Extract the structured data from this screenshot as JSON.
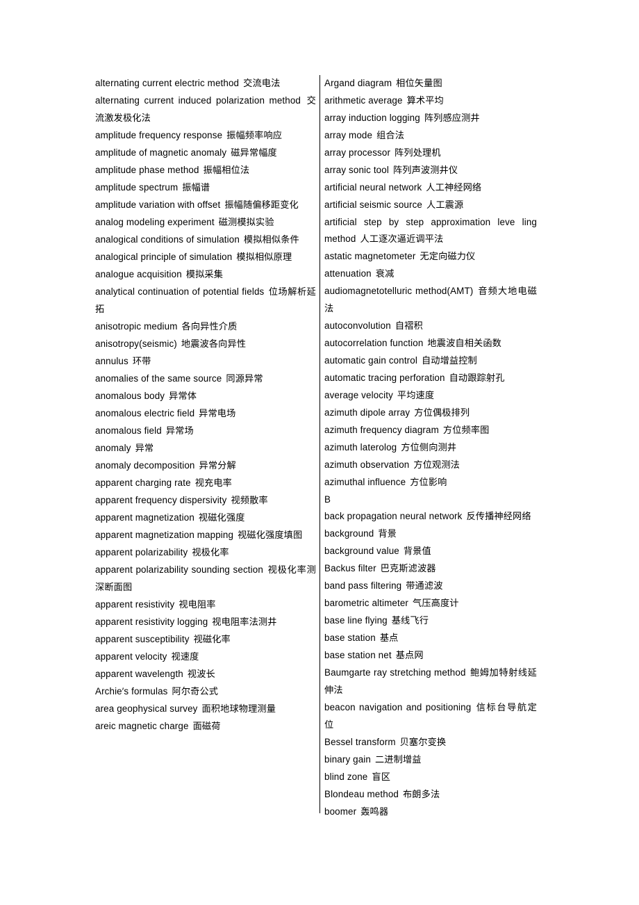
{
  "document": {
    "type": "bilingual-glossary",
    "page_background": "#ffffff",
    "text_color": "#000000",
    "divider_color": "#000000",
    "columns": 2
  },
  "left_column": {
    "entries": [
      {
        "en": "alternating current electric method",
        "zh": "交流电法"
      },
      {
        "en": "alternating current induced polarization method",
        "zh": "交流激发极化法"
      },
      {
        "en": "amplitude frequency response",
        "zh": "振幅频率响应"
      },
      {
        "en": "amplitude of magnetic anomaly",
        "zh": "磁异常幅度"
      },
      {
        "en": "amplitude phase method",
        "zh": "振幅相位法"
      },
      {
        "en": "amplitude spectrum",
        "zh": "振幅谱"
      },
      {
        "en": "amplitude variation with offset",
        "zh": "振幅随偏移距变化"
      },
      {
        "en": "analog modeling experiment",
        "zh": "磁测模拟实验"
      },
      {
        "en": "analogical conditions of simulation",
        "zh": "模拟相似条件"
      },
      {
        "en": "analogical principle of simulation",
        "zh": "模拟相似原理"
      },
      {
        "en": "analogue acquisition",
        "zh": "模拟采集"
      },
      {
        "en": "analytical continuation of potential fields",
        "zh": "位场解析延拓"
      },
      {
        "en": "anisotropic medium",
        "zh": "各向异性介质"
      },
      {
        "en": "anisotropy(seismic)",
        "zh": "地震波各向异性"
      },
      {
        "en": "annulus",
        "zh": "环带"
      },
      {
        "en": "anomalies of the same source",
        "zh": "同源异常"
      },
      {
        "en": "anomalous body",
        "zh": "异常体"
      },
      {
        "en": "anomalous electric field",
        "zh": "异常电场"
      },
      {
        "en": "anomalous field",
        "zh": "异常场"
      },
      {
        "en": "anomaly",
        "zh": "异常"
      },
      {
        "en": "anomaly decomposition",
        "zh": "异常分解"
      },
      {
        "en": "apparent charging rate",
        "zh": "视充电率"
      },
      {
        "en": "apparent frequency dispersivity",
        "zh": "视频散率"
      },
      {
        "en": "apparent magnetization",
        "zh": "视磁化强度"
      },
      {
        "en": "apparent magnetization mapping",
        "zh": "视磁化强度填图"
      },
      {
        "en": "apparent polarizability",
        "zh": "视极化率"
      },
      {
        "en": "apparent polarizability sounding section",
        "zh": "视极化率测深断面图"
      },
      {
        "en": "apparent resistivity",
        "zh": "视电阻率"
      },
      {
        "en": "apparent resistivity logging",
        "zh": "视电阻率法测井"
      },
      {
        "en": "apparent susceptibility",
        "zh": "视磁化率"
      },
      {
        "en": "apparent velocity",
        "zh": "视速度"
      },
      {
        "en": "apparent wavelength",
        "zh": "视波长"
      },
      {
        "en": "Archie′s formulas",
        "zh": "阿尔奇公式"
      },
      {
        "en": "area geophysical survey",
        "zh": "面积地球物理测量"
      },
      {
        "en": "areic magnetic charge",
        "zh": "面磁荷"
      }
    ]
  },
  "right_column": {
    "entries": [
      {
        "en": "Argand diagram",
        "zh": "相位矢量图"
      },
      {
        "en": "arithmetic average",
        "zh": "算术平均"
      },
      {
        "en": "array induction logging",
        "zh": "阵列感应测井"
      },
      {
        "en": "array mode",
        "zh": "组合法"
      },
      {
        "en": "array processor",
        "zh": "阵列处理机"
      },
      {
        "en": "array sonic tool",
        "zh": "阵列声波测井仪"
      },
      {
        "en": "artificial neural network",
        "zh": "人工神经网络"
      },
      {
        "en": "artificial seismic source",
        "zh": "人工震源"
      },
      {
        "en": "artificial step by step approximation leve ling method",
        "zh": "人工逐次逼近调平法"
      },
      {
        "en": "astatic magnetometer",
        "zh": "无定向磁力仪"
      },
      {
        "en": "attenuation",
        "zh": "衰减"
      },
      {
        "en": "audiomagnetotelluric method(AMT)",
        "zh": "音频大地电磁法"
      },
      {
        "en": "autoconvolution",
        "zh": "自褶积"
      },
      {
        "en": "autocorrelation function",
        "zh": "地震波自相关函数"
      },
      {
        "en": "automatic gain control",
        "zh": "自动增益控制"
      },
      {
        "en": "automatic tracing perforation",
        "zh": "自动跟踪射孔"
      },
      {
        "en": "average velocity",
        "zh": "平均速度"
      },
      {
        "en": "azimuth dipole array",
        "zh": "方位偶极排列"
      },
      {
        "en": "azimuth frequency diagram",
        "zh": "方位频率图"
      },
      {
        "en": "azimuth laterolog",
        "zh": "方位侧向测井"
      },
      {
        "en": "azimuth observation",
        "zh": "方位观测法"
      },
      {
        "en": "azimuthal influence",
        "zh": "方位影响"
      },
      {
        "en": "B",
        "zh": ""
      },
      {
        "en": "back propagation neural network",
        "zh": "反传播神经网络"
      },
      {
        "en": "background",
        "zh": "背景"
      },
      {
        "en": "background value",
        "zh": "背景值"
      },
      {
        "en": "Backus filter",
        "zh": "巴克斯滤波器"
      },
      {
        "en": "band pass filtering",
        "zh": "带通滤波"
      },
      {
        "en": "barometric altimeter",
        "zh": "气压高度计"
      },
      {
        "en": "base line flying",
        "zh": "基线飞行"
      },
      {
        "en": "base station",
        "zh": "基点"
      },
      {
        "en": "base station net",
        "zh": "基点网"
      },
      {
        "en": "Baumgarte ray stretching method",
        "zh": "鲍姆加特射线延伸法"
      },
      {
        "en": "beacon navigation and positioning",
        "zh": "信标台导航定位"
      },
      {
        "en": "Bessel transform",
        "zh": "贝塞尔变换"
      },
      {
        "en": "binary gain",
        "zh": "二进制增益"
      },
      {
        "en": "blind zone",
        "zh": "盲区"
      },
      {
        "en": "Blondeau method",
        "zh": "布朗多法"
      },
      {
        "en": "boomer",
        "zh": "轰鸣器"
      }
    ]
  }
}
